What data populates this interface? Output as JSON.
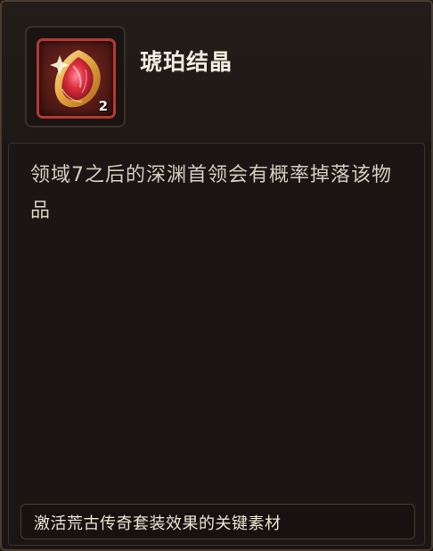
{
  "item": {
    "name": "琥珀结晶",
    "quantity": "2",
    "icon": "amber-crystal-icon",
    "rarity_color": "#b43a32"
  },
  "description": {
    "text": "领域7之后的深渊首领会有概率掉落该物品"
  },
  "footer": {
    "text": "激活荒古传奇套装效果的关键素材"
  }
}
